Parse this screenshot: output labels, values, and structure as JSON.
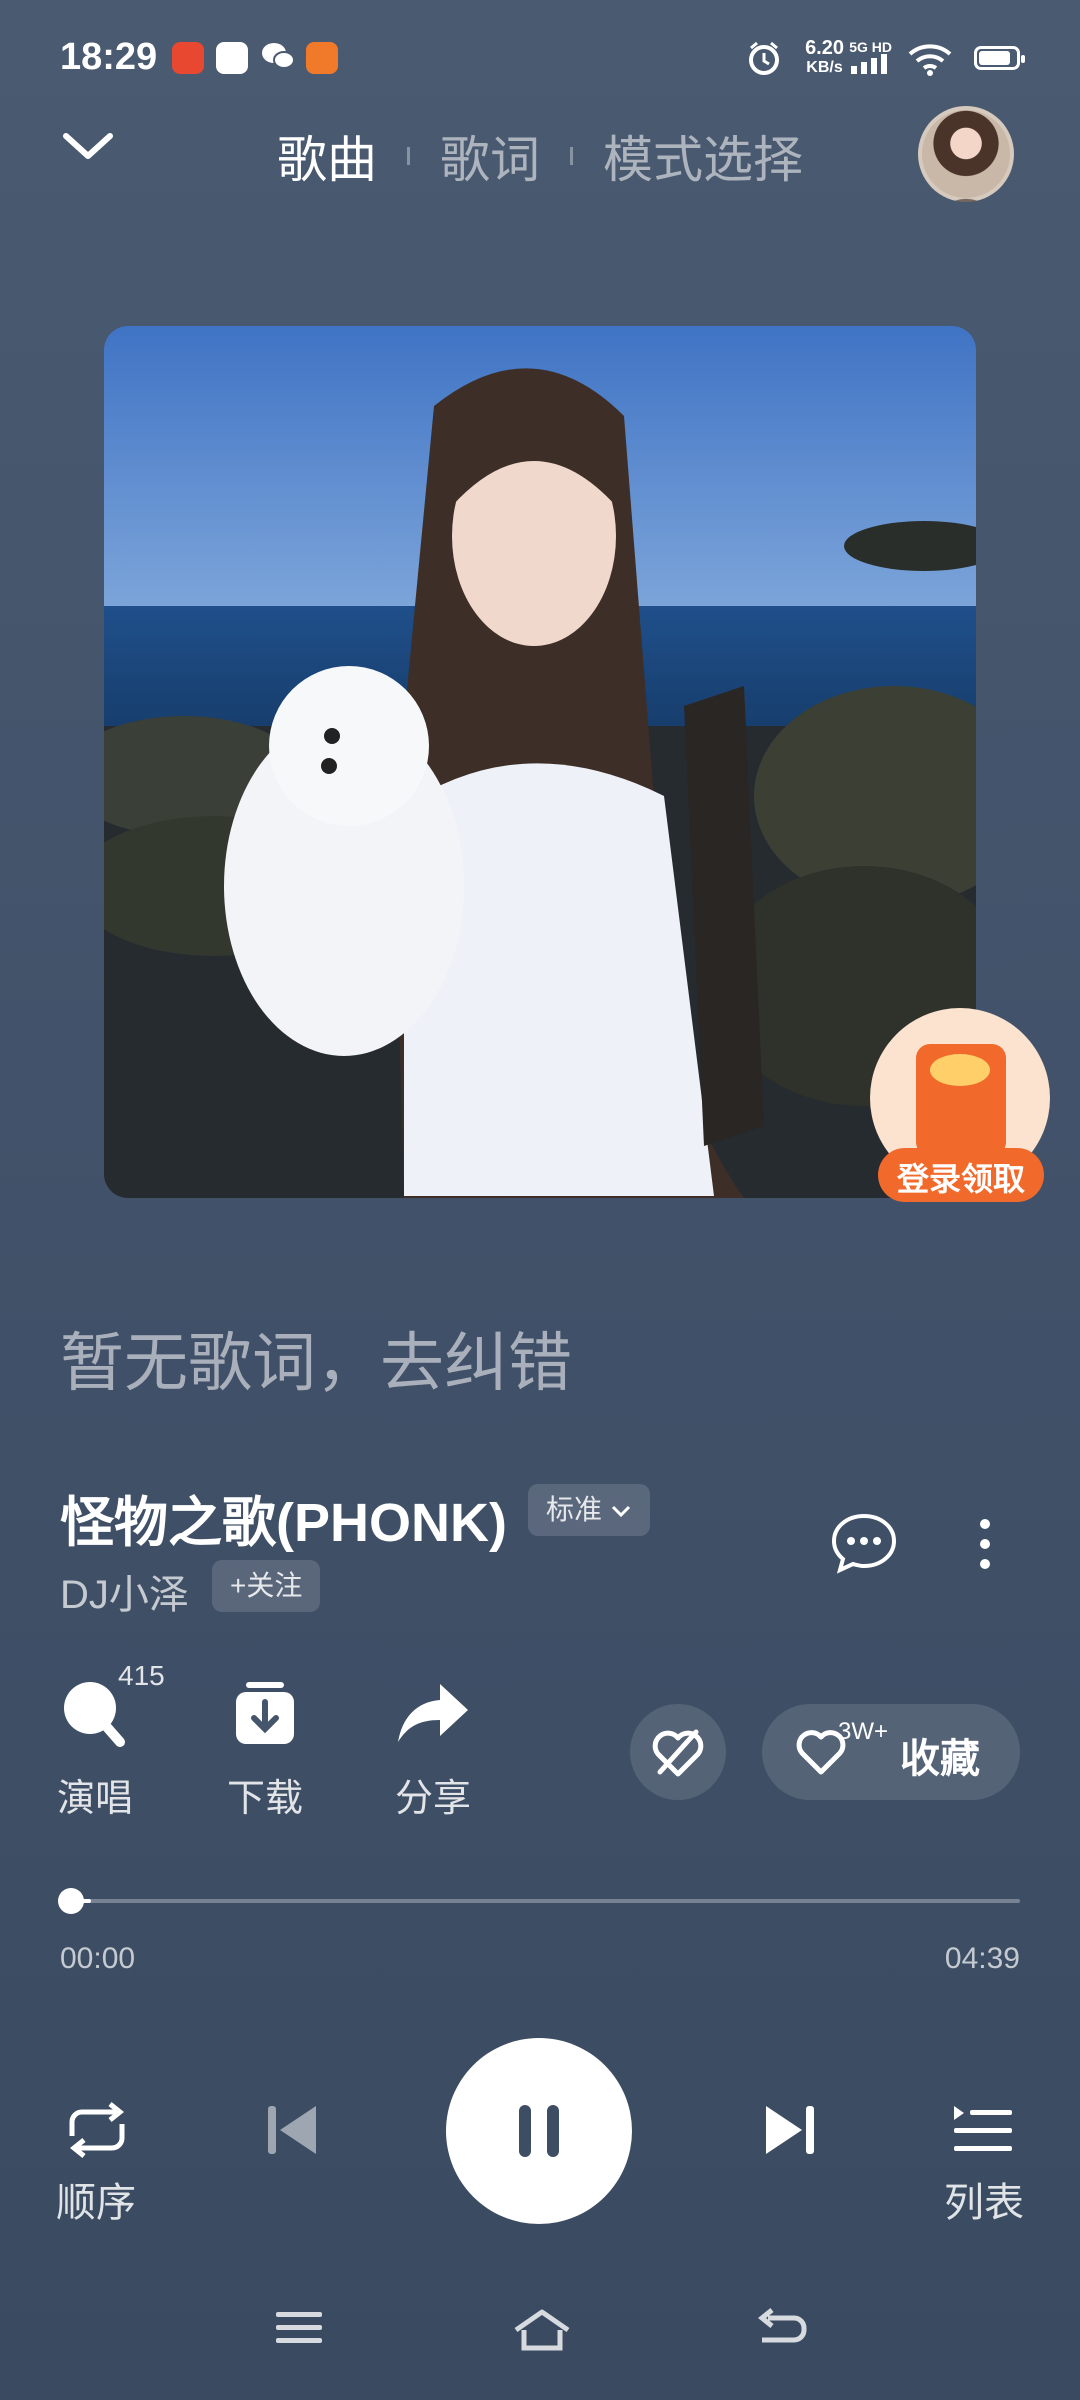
{
  "status_bar": {
    "time": "18:29",
    "net_speed_value": "6.20",
    "net_speed_unit": "KB/s",
    "signal_label": "5G HD",
    "battery_level": 0.85
  },
  "header": {
    "tabs": [
      "歌曲",
      "歌词",
      "模式选择"
    ],
    "active_tab": 0
  },
  "promo": {
    "label": "登录领取"
  },
  "lyrics": {
    "placeholder": "暂无歌词，去纠错"
  },
  "song": {
    "title": "怪物之歌(PHONK)",
    "quality": "标准",
    "artist": "DJ小泽",
    "follow_label": "+关注"
  },
  "actions": {
    "sing_label": "演唱",
    "sing_count": "415",
    "download_label": "下载",
    "share_label": "分享",
    "collect_label": "收藏",
    "collect_count": "3W+"
  },
  "progress": {
    "current": "00:00",
    "total": "04:39",
    "fraction": 0.02
  },
  "controls": {
    "mode_label": "顺序",
    "playlist_label": "列表",
    "state": "playing"
  },
  "icons": {
    "back": "chevron-down-icon",
    "comment": "comment-icon",
    "more": "more-vertical-icon",
    "prev": "skip-previous-icon",
    "next": "skip-next-icon",
    "pause": "pause-icon",
    "repeat": "repeat-icon",
    "playlist": "playlist-icon"
  },
  "colors": {
    "background": "#45556b",
    "promo_orange": "#f26a2b"
  }
}
